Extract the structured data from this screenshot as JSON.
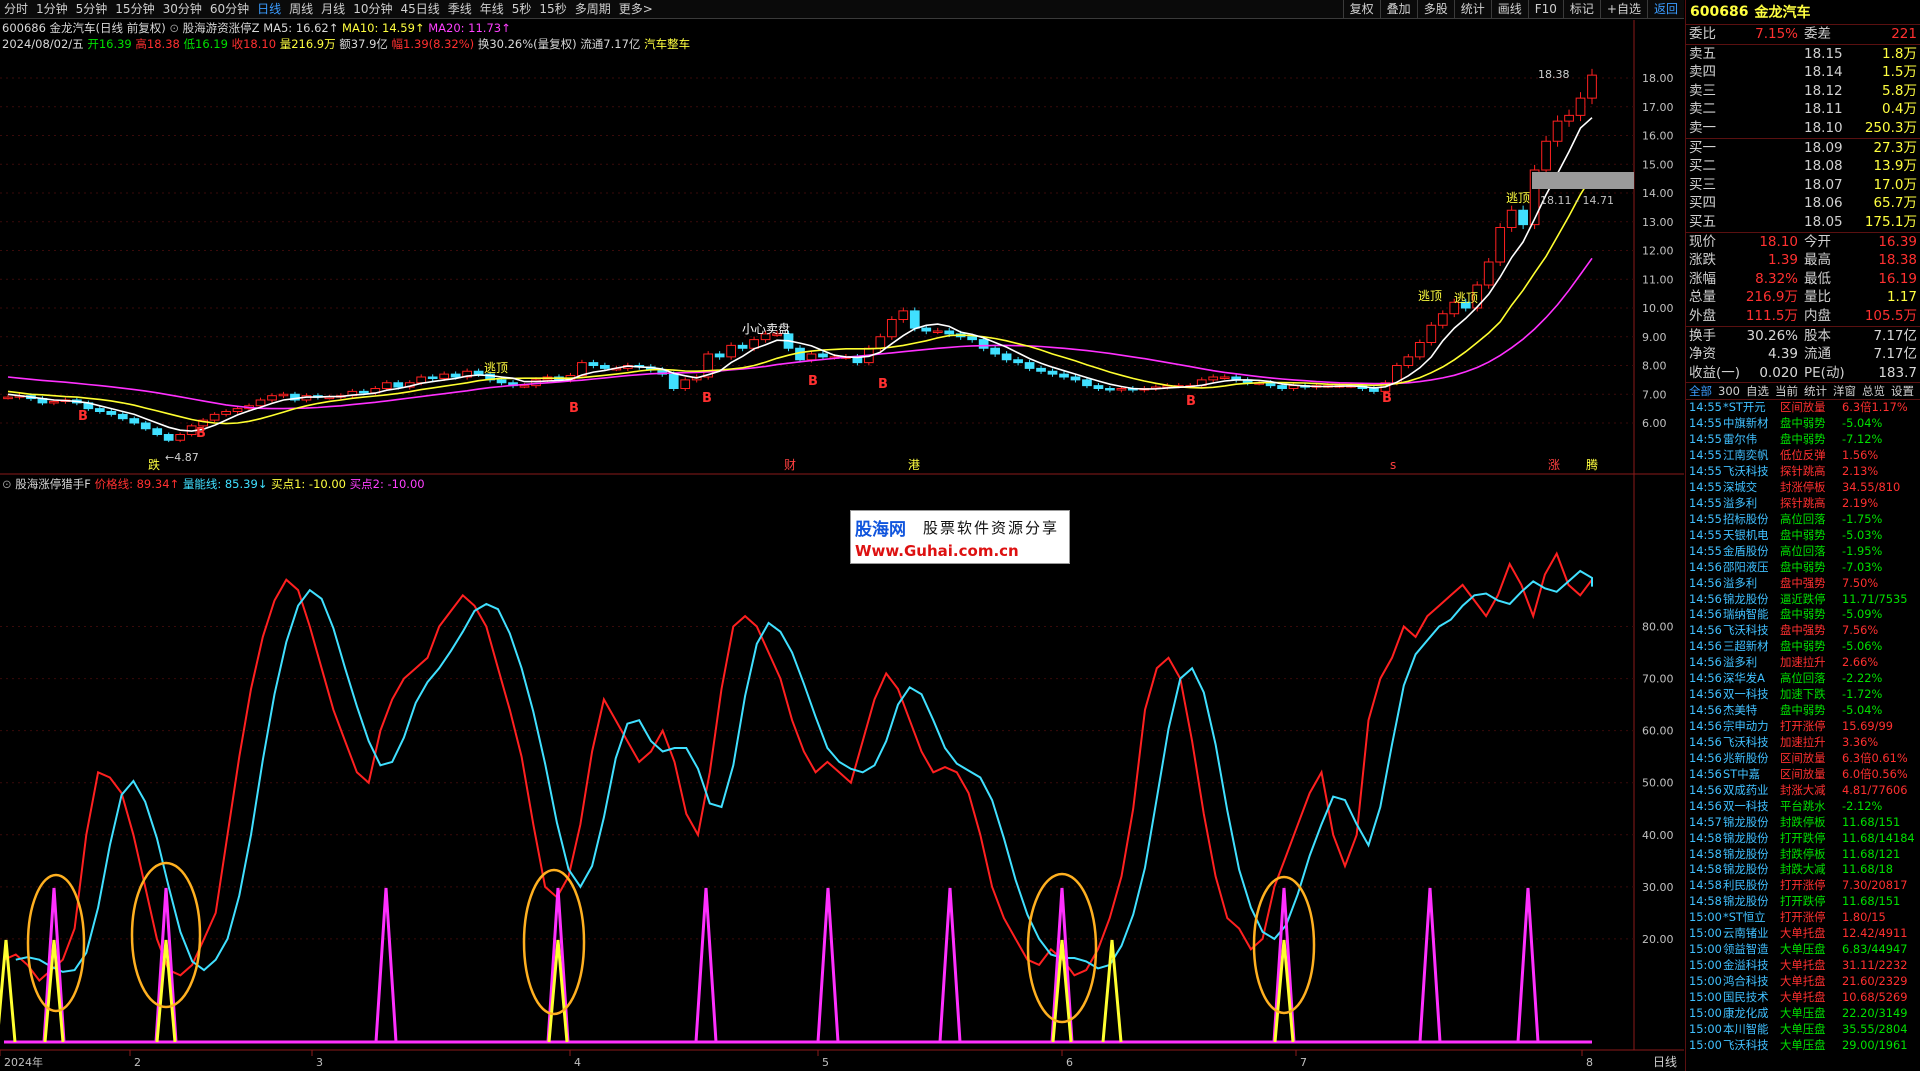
{
  "toolbar": {
    "periods": [
      "分时",
      "1分钟",
      "5分钟",
      "15分钟",
      "30分钟",
      "60分钟",
      "日线",
      "周线",
      "月线",
      "10分钟",
      "45日线",
      "季线",
      "年线",
      "5秒",
      "15秒",
      "多周期",
      "更多>"
    ],
    "active_period": "日线",
    "tools": [
      "复权",
      "叠加",
      "多股",
      "统计",
      "画线",
      "F10",
      "标记",
      "+自选",
      "返回"
    ],
    "selected_tool": "返回"
  },
  "header": {
    "stock_label": "600686 金龙汽车(日线 前复权)",
    "indicator_name": "股海游资涨停Z",
    "ma5": "MA5: 16.62↑",
    "ma10": "MA10: 14.59↑",
    "ma20": "MA20: 11.73↑",
    "date": "2024/08/02/五",
    "open": "开16.39",
    "high": "高18.38",
    "low": "低16.19",
    "close": "收18.10",
    "volume": "量216.9万",
    "amount": "额37.9亿",
    "change": "幅1.39(8.32%)",
    "turnover": "换30.26%(量复权)",
    "float_cap": "流通7.17亿",
    "sector": "汽车整车"
  },
  "indicator": {
    "name": "股海涨停猎手F",
    "price_line": "价格线: 89.34↑",
    "volume_line": "量能线: 85.39↓",
    "buy1": "买点1: -10.00",
    "buy2": "买点2: -10.00"
  },
  "chart_data": {
    "type": "candlestick",
    "price_axis": {
      "ticks": [
        "18.00",
        "17.00",
        "16.00",
        "15.00",
        "14.00",
        "13.00",
        "12.00",
        "11.00",
        "10.00",
        "9.00",
        "8.00",
        "7.00",
        "6.00"
      ],
      "min": 6.0,
      "max": 18.0
    },
    "indicator_axis": {
      "ticks": [
        "80.00",
        "70.00",
        "60.00",
        "50.00",
        "40.00",
        "30.00",
        "20.00"
      ],
      "min": 0,
      "max": 100
    },
    "x_ticks": [
      "2024年",
      "2",
      "3",
      "4",
      "5",
      "6",
      "7",
      "8"
    ],
    "annotations": {
      "high_label": "18.38",
      "low_label": "4.87",
      "range_label": "18.11 - 14.71",
      "text_small_caution": "小心卖盘",
      "escape_top": "逃顶",
      "buy_mark": "B",
      "event_labels": [
        "跌",
        "财",
        "港",
        "s",
        "涨",
        "腾"
      ]
    },
    "price_close": [
      6.9,
      6.95,
      6.85,
      6.7,
      6.75,
      6.8,
      6.7,
      6.5,
      6.4,
      6.3,
      6.15,
      6.0,
      5.8,
      5.6,
      5.4,
      5.6,
      5.9,
      6.1,
      6.3,
      6.4,
      6.5,
      6.6,
      6.8,
      6.95,
      7.0,
      6.8,
      6.95,
      6.9,
      6.9,
      6.95,
      7.1,
      7.05,
      7.2,
      7.4,
      7.25,
      7.4,
      7.6,
      7.55,
      7.7,
      7.6,
      7.8,
      7.7,
      7.5,
      7.4,
      7.3,
      7.3,
      7.5,
      7.6,
      7.5,
      7.65,
      8.1,
      8.0,
      7.9,
      7.9,
      8.0,
      7.95,
      7.85,
      7.7,
      7.2,
      7.5,
      7.6,
      8.4,
      8.3,
      8.7,
      8.6,
      8.9,
      9.1,
      9.1,
      8.6,
      8.2,
      8.4,
      8.3,
      8.3,
      8.3,
      8.1,
      8.6,
      9.0,
      9.6,
      9.9,
      9.3,
      9.2,
      9.2,
      9.1,
      9.0,
      8.9,
      8.6,
      8.4,
      8.2,
      8.1,
      7.9,
      7.8,
      7.7,
      7.6,
      7.5,
      7.3,
      7.2,
      7.15,
      7.2,
      7.15,
      7.2,
      7.25,
      7.3,
      7.3,
      7.3,
      7.5,
      7.6,
      7.6,
      7.5,
      7.4,
      7.4,
      7.3,
      7.2,
      7.3,
      7.25,
      7.3,
      7.3,
      7.3,
      7.3,
      7.2,
      7.1,
      7.4,
      8.0,
      8.3,
      8.8,
      9.4,
      9.8,
      10.2,
      10.0,
      10.8,
      11.6,
      12.8,
      13.4,
      12.9,
      14.8,
      15.8,
      16.5,
      16.7,
      17.3,
      18.1
    ],
    "ma5": [
      7.0,
      6.95,
      6.9,
      6.85,
      6.8,
      6.78,
      6.75,
      6.7,
      6.6,
      6.5,
      6.4,
      6.3,
      6.15,
      6.0,
      5.85,
      5.75,
      5.72,
      5.78,
      5.92,
      6.1,
      6.28,
      6.42,
      6.55,
      6.68,
      6.8,
      6.85,
      6.9,
      6.9,
      6.92,
      6.92,
      6.97,
      7.0,
      7.04,
      7.14,
      7.2,
      7.28,
      7.38,
      7.44,
      7.5,
      7.55,
      7.63,
      7.67,
      7.65,
      7.6,
      7.56,
      7.44,
      7.44,
      7.46,
      7.48,
      7.51,
      7.67,
      7.77,
      7.83,
      7.91,
      7.98,
      7.95,
      7.93,
      7.88,
      7.73,
      7.64,
      7.57,
      7.68,
      7.8,
      8.1,
      8.32,
      8.58,
      8.72,
      8.88,
      8.86,
      8.78,
      8.68,
      8.52,
      8.36,
      8.3,
      8.28,
      8.32,
      8.46,
      8.76,
      9.04,
      9.28,
      9.4,
      9.44,
      9.36,
      9.16,
      9.08,
      8.96,
      8.8,
      8.64,
      8.44,
      8.24,
      8.08,
      7.94,
      7.82,
      7.7,
      7.58,
      7.46,
      7.35,
      7.27,
      7.2,
      7.18,
      7.19,
      7.22,
      7.24,
      7.27,
      7.31,
      7.39,
      7.46,
      7.5,
      7.5,
      7.48,
      7.44,
      7.36,
      7.32,
      7.29,
      7.27,
      7.27,
      7.28,
      7.29,
      7.27,
      7.22,
      7.26,
      7.42,
      7.64,
      7.92,
      8.3,
      8.86,
      9.3,
      9.64,
      10.04,
      10.48,
      11.08,
      11.76,
      12.3,
      13.1,
      13.94,
      14.68,
      15.44,
      16.26,
      16.62
    ],
    "ma10": [
      7.1,
      7.05,
      7.0,
      6.98,
      6.95,
      6.92,
      6.9,
      6.86,
      6.82,
      6.77,
      6.7,
      6.62,
      6.52,
      6.42,
      6.32,
      6.22,
      6.12,
      6.05,
      6.0,
      5.98,
      6.0,
      6.06,
      6.15,
      6.26,
      6.38,
      6.5,
      6.6,
      6.68,
      6.75,
      6.8,
      6.86,
      6.9,
      6.94,
      6.98,
      7.03,
      7.09,
      7.16,
      7.22,
      7.28,
      7.34,
      7.4,
      7.47,
      7.52,
      7.55,
      7.55,
      7.56,
      7.56,
      7.56,
      7.56,
      7.56,
      7.58,
      7.62,
      7.66,
      7.7,
      7.75,
      7.81,
      7.85,
      7.86,
      7.84,
      7.81,
      7.8,
      7.82,
      7.84,
      7.88,
      7.92,
      8.0,
      8.12,
      8.25,
      8.36,
      8.45,
      8.5,
      8.54,
      8.56,
      8.58,
      8.58,
      8.58,
      8.6,
      8.64,
      8.7,
      8.78,
      8.86,
      8.96,
      9.04,
      9.06,
      9.04,
      9.0,
      8.94,
      8.86,
      8.76,
      8.66,
      8.54,
      8.4,
      8.28,
      8.16,
      8.02,
      7.9,
      7.77,
      7.66,
      7.55,
      7.46,
      7.38,
      7.31,
      7.26,
      7.23,
      7.22,
      7.24,
      7.29,
      7.35,
      7.38,
      7.4,
      7.41,
      7.41,
      7.4,
      7.39,
      7.37,
      7.35,
      7.34,
      7.34,
      7.33,
      7.31,
      7.33,
      7.37,
      7.45,
      7.58,
      7.75,
      7.95,
      8.2,
      8.48,
      8.8,
      9.13,
      9.52,
      10.1,
      10.62,
      11.22,
      11.8,
      12.5,
      13.2,
      13.95,
      14.59
    ],
    "ma20": [
      7.6,
      7.56,
      7.52,
      7.48,
      7.45,
      7.42,
      7.38,
      7.34,
      7.3,
      7.26,
      7.21,
      7.16,
      7.11,
      7.05,
      6.98,
      6.91,
      6.84,
      6.77,
      6.7,
      6.63,
      6.58,
      6.54,
      6.51,
      6.5,
      6.5,
      6.51,
      6.52,
      6.54,
      6.57,
      6.6,
      6.64,
      6.68,
      6.72,
      6.77,
      6.82,
      6.87,
      6.92,
      6.97,
      7.02,
      7.07,
      7.12,
      7.18,
      7.23,
      7.27,
      7.31,
      7.34,
      7.37,
      7.4,
      7.43,
      7.46,
      7.49,
      7.53,
      7.57,
      7.61,
      7.65,
      7.68,
      7.71,
      7.73,
      7.74,
      7.75,
      7.76,
      7.78,
      7.81,
      7.85,
      7.88,
      7.92,
      7.97,
      8.03,
      8.08,
      8.13,
      8.17,
      8.21,
      8.25,
      8.29,
      8.32,
      8.36,
      8.4,
      8.44,
      8.48,
      8.52,
      8.56,
      8.6,
      8.63,
      8.66,
      8.68,
      8.69,
      8.7,
      8.7,
      8.69,
      8.68,
      8.66,
      8.63,
      8.6,
      8.56,
      8.52,
      8.47,
      8.42,
      8.36,
      8.3,
      8.24,
      8.17,
      8.1,
      8.03,
      7.96,
      7.89,
      7.82,
      7.76,
      7.71,
      7.66,
      7.61,
      7.57,
      7.53,
      7.5,
      7.47,
      7.44,
      7.42,
      7.4,
      7.39,
      7.38,
      7.37,
      7.37,
      7.38,
      7.4,
      7.44,
      7.5,
      7.57,
      7.66,
      7.78,
      7.93,
      8.12,
      8.35,
      8.62,
      8.92,
      9.27,
      9.67,
      10.12,
      10.62,
      11.17,
      11.73
    ],
    "line_price": [
      16,
      17,
      15,
      12,
      14,
      16,
      22,
      40,
      52,
      51,
      48,
      40,
      30,
      20,
      14,
      13,
      15,
      20,
      25,
      40,
      55,
      68,
      78,
      85,
      89,
      87,
      80,
      72,
      64,
      58,
      52,
      50,
      60,
      66,
      70,
      72,
      74,
      80,
      83,
      86,
      84,
      80,
      72,
      64,
      55,
      42,
      30,
      28,
      32,
      42,
      56,
      66,
      62,
      58,
      54,
      56,
      60,
      54,
      44,
      40,
      52,
      68,
      80,
      82,
      80,
      75,
      70,
      62,
      56,
      52,
      54,
      52,
      50,
      58,
      66,
      71,
      68,
      62,
      56,
      52,
      53,
      52,
      48,
      40,
      30,
      24,
      20,
      16,
      15,
      18,
      16,
      13,
      14,
      18,
      24,
      32,
      45,
      64,
      72,
      74,
      70,
      58,
      44,
      32,
      24,
      22,
      18,
      20,
      30,
      36,
      42,
      48,
      52,
      40,
      34,
      40,
      62,
      70,
      74,
      80,
      78,
      82,
      84,
      86,
      88,
      85,
      82,
      86,
      92,
      88,
      82,
      90,
      94,
      88,
      86,
      89
    ]
  },
  "quote": {
    "code": "600686",
    "name": "金龙汽车",
    "weibi_label": "委比",
    "weibi": "7.15%",
    "weicha_label": "委差",
    "weicha": "221",
    "asks": [
      {
        "label": "卖五",
        "price": "18.15",
        "vol": "1.8万"
      },
      {
        "label": "卖四",
        "price": "18.14",
        "vol": "1.5万"
      },
      {
        "label": "卖三",
        "price": "18.12",
        "vol": "5.8万"
      },
      {
        "label": "卖二",
        "price": "18.11",
        "vol": "0.4万"
      },
      {
        "label": "卖一",
        "price": "18.10",
        "vol": "250.3万"
      }
    ],
    "bids": [
      {
        "label": "买一",
        "price": "18.09",
        "vol": "27.3万"
      },
      {
        "label": "买二",
        "price": "18.08",
        "vol": "13.9万"
      },
      {
        "label": "买三",
        "price": "18.07",
        "vol": "17.0万"
      },
      {
        "label": "买四",
        "price": "18.06",
        "vol": "65.7万"
      },
      {
        "label": "买五",
        "price": "18.05",
        "vol": "175.1万"
      }
    ],
    "stats": [
      {
        "k1": "现价",
        "v1": "18.10",
        "k2": "今开",
        "v2": "16.39"
      },
      {
        "k1": "涨跌",
        "v1": "1.39",
        "k2": "最高",
        "v2": "18.38"
      },
      {
        "k1": "涨幅",
        "v1": "8.32%",
        "k2": "最低",
        "v2": "16.19"
      },
      {
        "k1": "总量",
        "v1": "216.9万",
        "k2": "量比",
        "v2": "1.17"
      },
      {
        "k1": "外盘",
        "v1": "111.5万",
        "k2": "内盘",
        "v2": "105.5万"
      }
    ],
    "stats2": [
      {
        "k1": "换手",
        "v1": "30.26%",
        "k2": "股本",
        "v2": "7.17亿"
      },
      {
        "k1": "净资",
        "v1": "4.39",
        "k2": "流通",
        "v2": "7.17亿"
      },
      {
        "k1": "收益(一)",
        "v1": "0.020",
        "k2": "PE(动)",
        "v2": "183.7"
      }
    ]
  },
  "side_tabs": [
    "全部",
    "300",
    "自选",
    "当前",
    "统计",
    "洋窗",
    "总览",
    "设置"
  ],
  "ticker": [
    [
      "14:55",
      "*ST开元",
      "区间放量",
      "6.3倍1.17%",
      "r"
    ],
    [
      "14:55",
      "中旗新材",
      "盘中弱势",
      "-5.04%",
      "g"
    ],
    [
      "14:55",
      "雷尔伟",
      "盘中弱势",
      "-7.12%",
      "g"
    ],
    [
      "14:55",
      "江南奕帆",
      "低位反弹",
      "1.56%",
      "r"
    ],
    [
      "14:55",
      "飞沃科技",
      "探针跳高",
      "2.13%",
      "r"
    ],
    [
      "14:55",
      "深城交",
      "封涨停板",
      "34.55/810",
      "r"
    ],
    [
      "14:55",
      "溢多利",
      "探针跳高",
      "2.19%",
      "r"
    ],
    [
      "14:55",
      "招标股份",
      "高位回落",
      "-1.75%",
      "g"
    ],
    [
      "14:55",
      "天银机电",
      "盘中弱势",
      "-5.03%",
      "g"
    ],
    [
      "14:55",
      "金盾股份",
      "高位回落",
      "-1.95%",
      "g"
    ],
    [
      "14:56",
      "邵阳液压",
      "盘中弱势",
      "-7.03%",
      "g"
    ],
    [
      "14:56",
      "溢多利",
      "盘中强势",
      "7.50%",
      "r"
    ],
    [
      "14:56",
      "锦龙股份",
      "逼近跌停",
      "11.71/7535",
      "g"
    ],
    [
      "14:56",
      "瑞纳智能",
      "盘中弱势",
      "-5.09%",
      "g"
    ],
    [
      "14:56",
      "飞沃科技",
      "盘中强势",
      "7.56%",
      "r"
    ],
    [
      "14:56",
      "三超新材",
      "盘中弱势",
      "-5.06%",
      "g"
    ],
    [
      "14:56",
      "溢多利",
      "加速拉升",
      "2.66%",
      "r"
    ],
    [
      "14:56",
      "深华发A",
      "高位回落",
      "-2.22%",
      "g"
    ],
    [
      "14:56",
      "双一科技",
      "加速下跌",
      "-1.72%",
      "g"
    ],
    [
      "14:56",
      "杰美特",
      "盘中弱势",
      "-5.04%",
      "g"
    ],
    [
      "14:56",
      "宗申动力",
      "打开涨停",
      "15.69/99",
      "r"
    ],
    [
      "14:56",
      "飞沃科技",
      "加速拉升",
      "3.36%",
      "r"
    ],
    [
      "14:56",
      "兆新股份",
      "区间放量",
      "6.3倍0.61%",
      "r"
    ],
    [
      "14:56",
      "ST中嘉",
      "区间放量",
      "6.0倍0.56%",
      "r"
    ],
    [
      "14:56",
      "双成药业",
      "封涨大减",
      "4.81/77606",
      "r"
    ],
    [
      "14:56",
      "双一科技",
      "平台跳水",
      "-2.12%",
      "g"
    ],
    [
      "14:57",
      "锦龙股份",
      "封跌停板",
      "11.68/151",
      "g"
    ],
    [
      "14:58",
      "锦龙股份",
      "打开跌停",
      "11.68/14184",
      "g"
    ],
    [
      "14:58",
      "锦龙股份",
      "封跌停板",
      "11.68/121",
      "g"
    ],
    [
      "14:58",
      "锦龙股份",
      "封跌大减",
      "11.68/18",
      "g"
    ],
    [
      "14:58",
      "利民股份",
      "打开涨停",
      "7.30/20817",
      "r"
    ],
    [
      "14:58",
      "锦龙股份",
      "打开跌停",
      "11.68/151",
      "g"
    ],
    [
      "15:00",
      "*ST恒立",
      "打开涨停",
      "1.80/15",
      "r"
    ],
    [
      "15:00",
      "云南锗业",
      "大单托盘",
      "12.42/4911",
      "r"
    ],
    [
      "15:00",
      "领益智造",
      "大单压盘",
      "6.83/44947",
      "g"
    ],
    [
      "15:00",
      "金溢科技",
      "大单托盘",
      "31.11/2232",
      "r"
    ],
    [
      "15:00",
      "鸿合科技",
      "大单托盘",
      "21.60/2329",
      "r"
    ],
    [
      "15:00",
      "国民技术",
      "大单托盘",
      "10.68/5269",
      "r"
    ],
    [
      "15:00",
      "康龙化成",
      "大单压盘",
      "22.20/3149",
      "g"
    ],
    [
      "15:00",
      "本川智能",
      "大单压盘",
      "35.55/2804",
      "g"
    ],
    [
      "15:00",
      "飞沃科技",
      "大单压盘",
      "29.00/1961",
      "g"
    ]
  ],
  "watermark": {
    "line1": "股海网",
    "line2": "股票软件资源分享",
    "line3": "Www.Guhai.com.cn"
  },
  "bottom": {
    "period_label": "日线"
  }
}
